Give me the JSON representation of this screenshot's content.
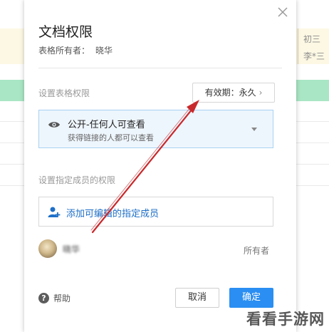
{
  "background_sheet": {
    "cells": [
      "初三",
      "李*三"
    ]
  },
  "dialog": {
    "title": "文档权限",
    "owner_label": "表格所有者：",
    "owner_name": "晓华",
    "section_permission_label": "设置表格权限",
    "validity_button": "有效期：永久",
    "permission_select": {
      "title": "公开-任何人可查看",
      "subtitle": "获得链接的人都可以查看",
      "icon": "eye-icon"
    },
    "section_members_label": "设置指定成员的权限",
    "add_member_label": "添加可编辑的指定成员",
    "members": [
      {
        "name": "晓华",
        "role": "所有者"
      }
    ],
    "help_label": "帮助",
    "cancel_label": "取消",
    "ok_label": "确定"
  },
  "colors": {
    "primary": "#2a8ef2",
    "link": "#1e6fc8",
    "arrow": "#c8292c"
  },
  "watermark": "看看手游网"
}
